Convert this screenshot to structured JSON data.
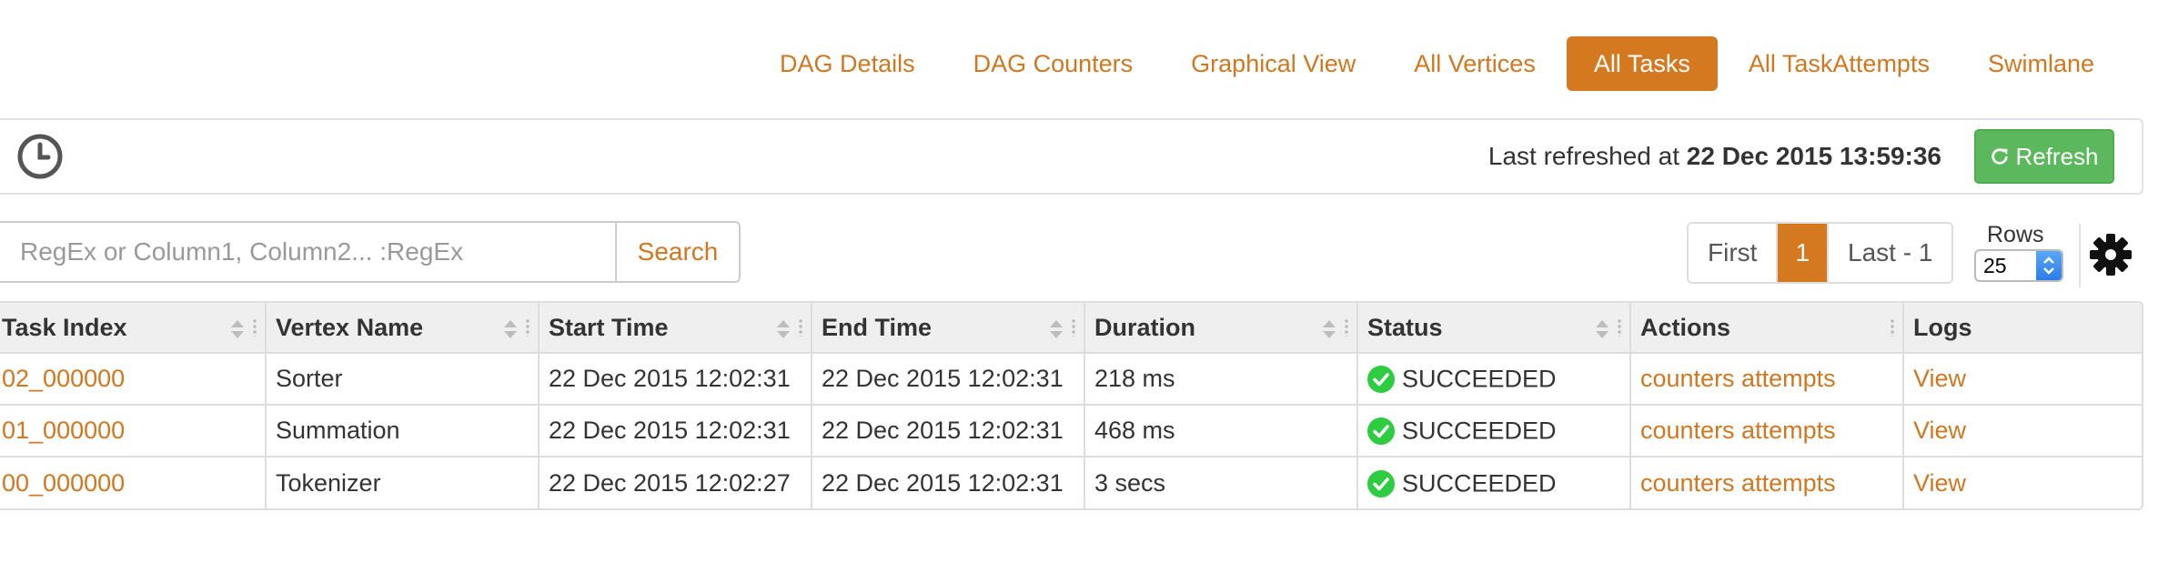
{
  "tabs": [
    {
      "label": "DAG Details",
      "active": false
    },
    {
      "label": "DAG Counters",
      "active": false
    },
    {
      "label": "Graphical View",
      "active": false
    },
    {
      "label": "All Vertices",
      "active": false
    },
    {
      "label": "All Tasks",
      "active": true
    },
    {
      "label": "All TaskAttempts",
      "active": false
    },
    {
      "label": "Swimlane",
      "active": false
    }
  ],
  "refresh_bar": {
    "prefix": "Last refreshed at ",
    "timestamp": "22 Dec 2015 13:59:36",
    "button_label": "Refresh"
  },
  "search": {
    "placeholder": "RegEx or Column1, Column2... :RegEx",
    "value": "",
    "button_label": "Search"
  },
  "pagination": {
    "first_label": "First",
    "current_page": "1",
    "last_label": "Last - 1"
  },
  "rows_control": {
    "label": "Rows",
    "selected": "25"
  },
  "table": {
    "headers": [
      "Task Index",
      "Vertex Name",
      "Start Time",
      "End Time",
      "Duration",
      "Status",
      "Actions",
      "Logs"
    ],
    "rows": [
      {
        "task_index": "02_000000",
        "vertex_name": "Sorter",
        "start_time": "22 Dec 2015 12:02:31",
        "end_time": "22 Dec 2015 12:02:31",
        "duration": "218 ms",
        "status": "SUCCEEDED",
        "actions": "counters attempts",
        "logs": "View"
      },
      {
        "task_index": "01_000000",
        "vertex_name": "Summation",
        "start_time": "22 Dec 2015 12:02:31",
        "end_time": "22 Dec 2015 12:02:31",
        "duration": "468 ms",
        "status": "SUCCEEDED",
        "actions": "counters attempts",
        "logs": "View"
      },
      {
        "task_index": "00_000000",
        "vertex_name": "Tokenizer",
        "start_time": "22 Dec 2015 12:02:27",
        "end_time": "22 Dec 2015 12:02:31",
        "duration": "3 secs",
        "status": "SUCCEEDED",
        "actions": "counters attempts",
        "logs": "View"
      }
    ]
  },
  "colors": {
    "accent": "#d4791f",
    "link": "#d0771f",
    "success": "#5cb85c",
    "status_icon": "#2ecc40"
  },
  "icons": {
    "clock": "clock-icon",
    "refresh": "refresh-icon",
    "gear": "gear-icon",
    "sort": "sort-icon",
    "status_success": "check-circle-icon"
  }
}
